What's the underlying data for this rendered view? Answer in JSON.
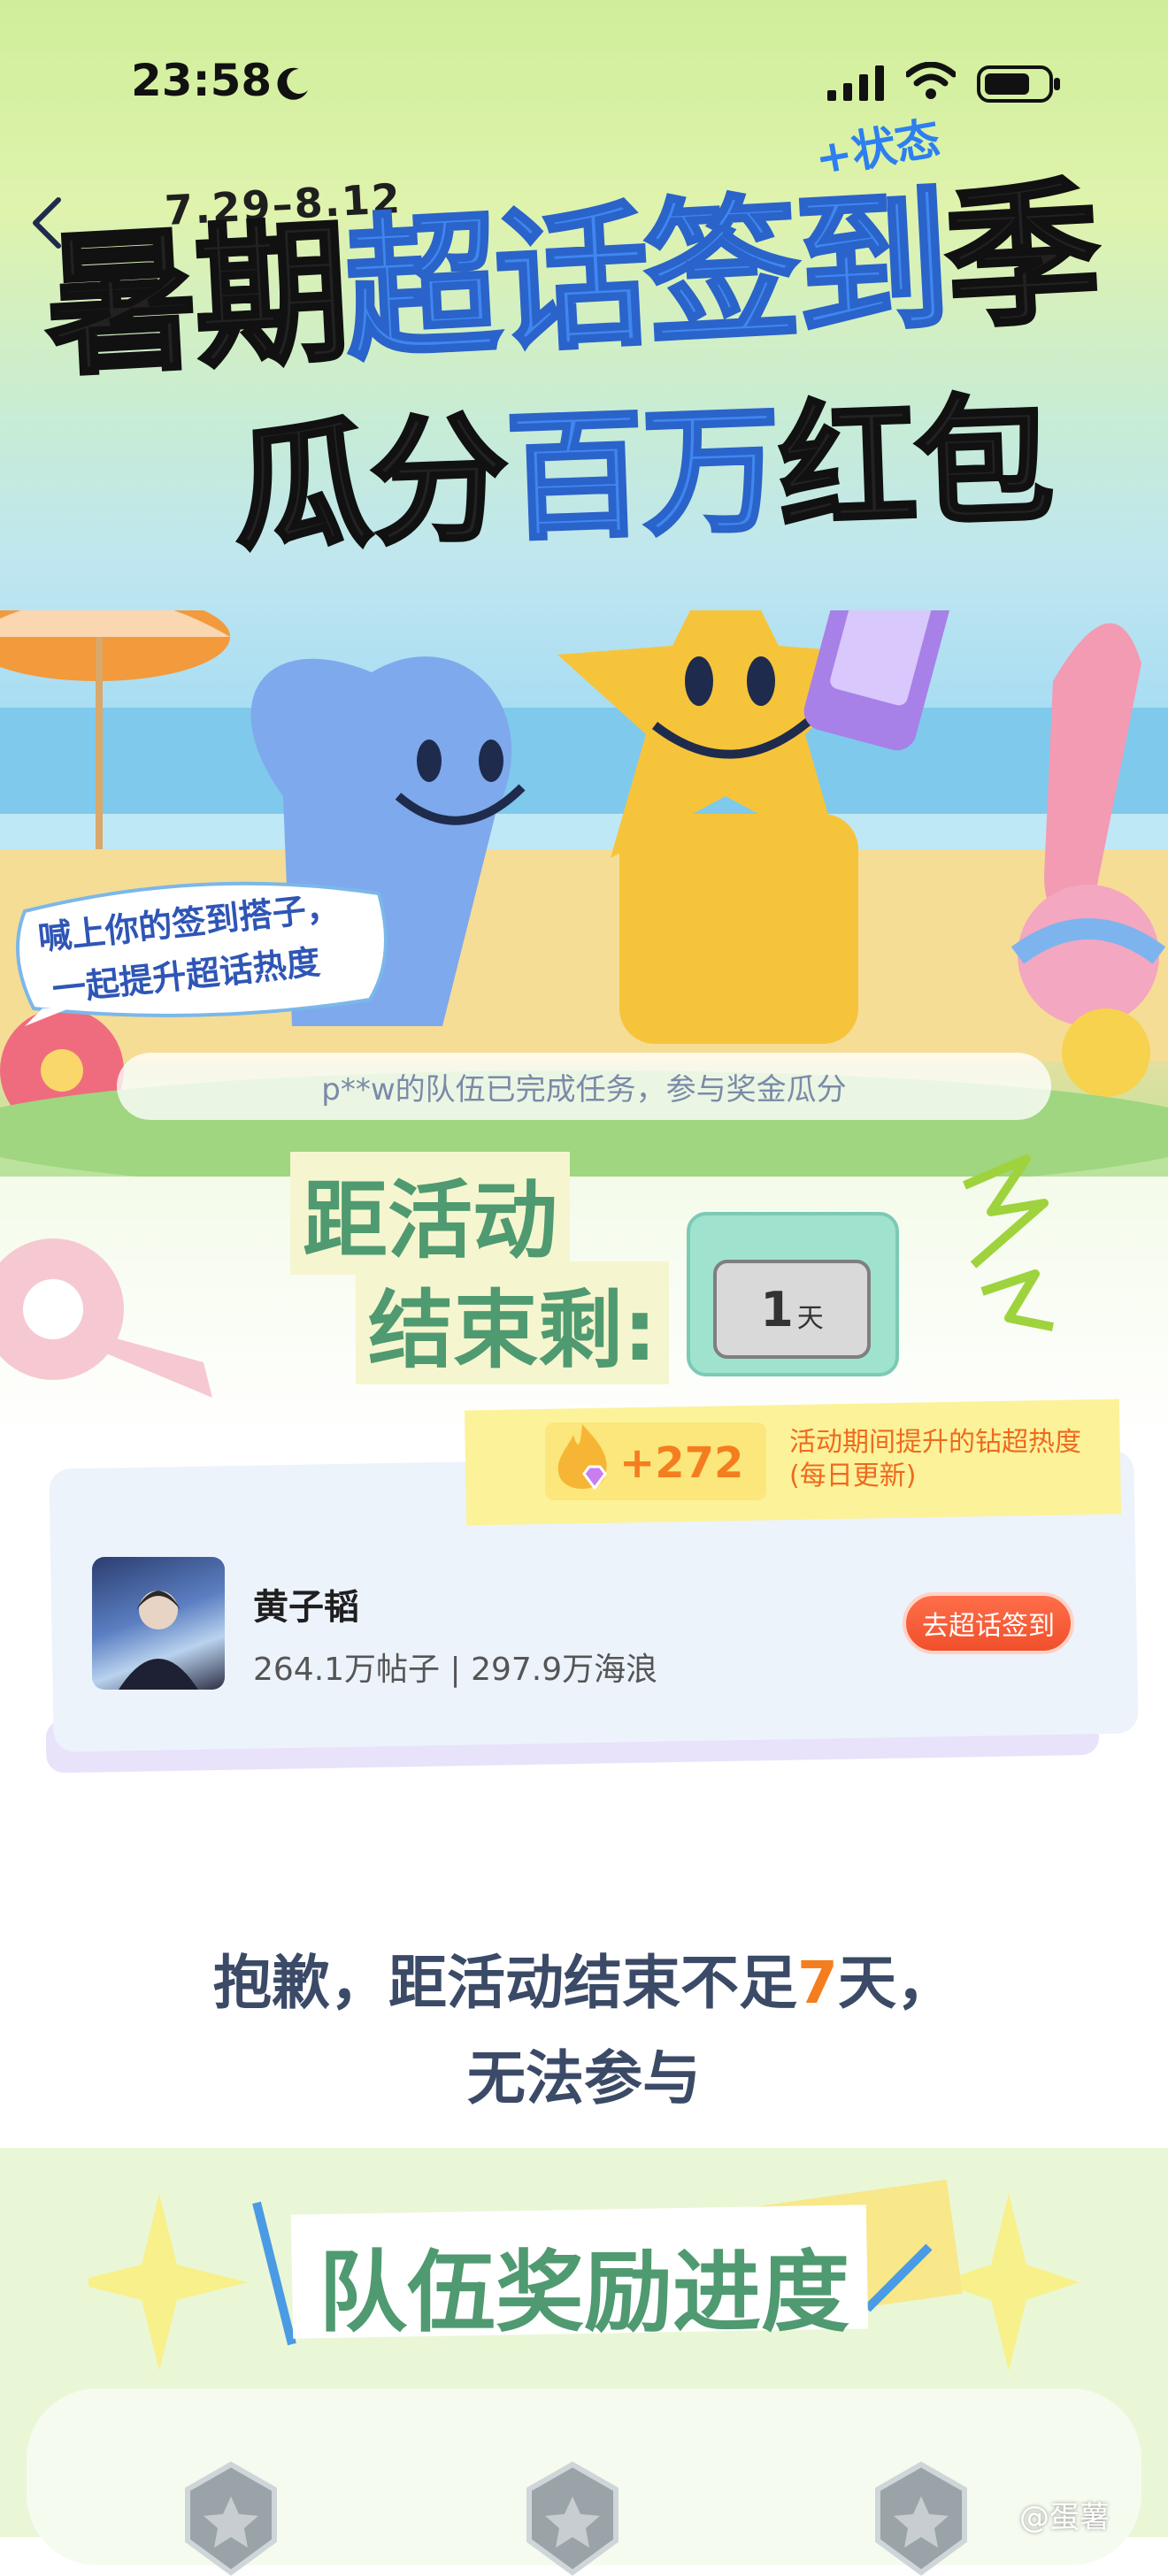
{
  "status_bar": {
    "time": "23:58"
  },
  "header": {
    "date_range": "7.29–8.12",
    "state_tag": "+状态",
    "title_line1_dark_a": "暑期",
    "title_line1_blue": "超话签到",
    "title_line1_dark_b": "季",
    "title_line2_dark_a": "瓜分",
    "title_line2_blue": "百万",
    "title_line2_dark_b": "红包"
  },
  "speech_bubble": {
    "line1": "喊上你的签到搭子，",
    "line2": "一起提升超话热度"
  },
  "notice": "p**w的队伍已完成任务，参与奖金瓜分",
  "countdown": {
    "label_line1": "距活动",
    "label_line2": "结束剩:",
    "value": "1",
    "unit": "天"
  },
  "heat": {
    "value": "+272",
    "description": "活动期间提升的钻超热度(每日更新)"
  },
  "supertopic_card": {
    "name": "黄子韬",
    "stats": "264.1万帖子 | 297.9万海浪",
    "button_label": "去超话签到"
  },
  "message": {
    "line1_a": "抱歉，距活动结束不足",
    "line1_highlight": "7",
    "line1_b": "天，",
    "line2": "无法参与"
  },
  "team_section": {
    "title": "队伍奖励进度"
  },
  "watermark": "@蛋薯",
  "colors": {
    "accent_blue": "#3f86f0",
    "accent_green": "#4f9a70",
    "accent_orange": "#f47e1f",
    "button_red": "#f0502b"
  }
}
